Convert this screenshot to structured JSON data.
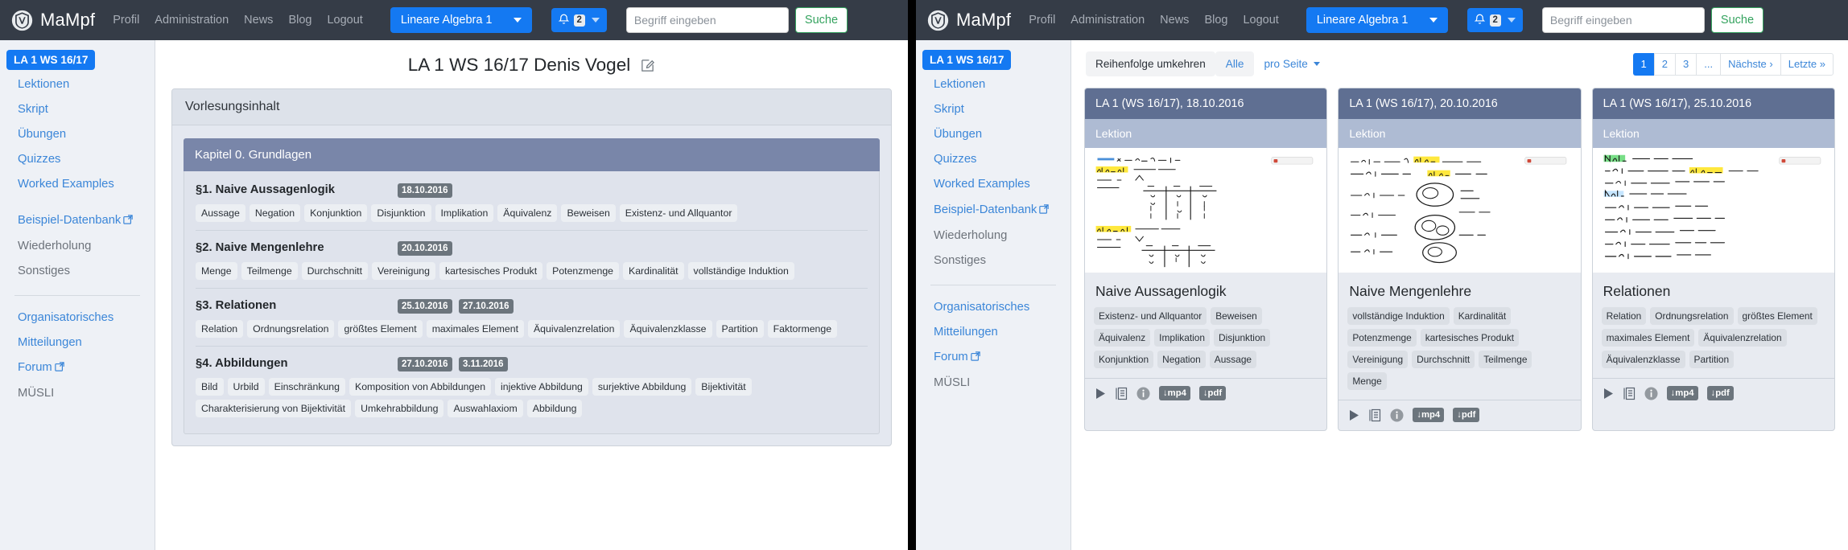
{
  "navbar": {
    "brand": "MaMpf",
    "logo_icon": "mampf-shield-logo-icon",
    "links": [
      "Profil",
      "Administration",
      "News",
      "Blog",
      "Logout"
    ],
    "course_selector": {
      "label": "Lineare Algebra 1",
      "icon": "chevron-down-icon"
    },
    "notifications": {
      "icon": "bell-icon",
      "count": "2",
      "caret_icon": "chevron-down-icon"
    },
    "search": {
      "placeholder": "Begriff eingeben",
      "value": "",
      "button": "Suche",
      "icon": "search-icon"
    }
  },
  "sidebar": {
    "badge": "LA 1 WS 16/17",
    "group1": [
      {
        "label": "Lektionen",
        "muted": false,
        "external": false
      },
      {
        "label": "Skript",
        "muted": false,
        "external": false
      },
      {
        "label": "Übungen",
        "muted": false,
        "external": false
      },
      {
        "label": "Quizzes",
        "muted": false,
        "external": false
      },
      {
        "label": "Worked Examples",
        "muted": false,
        "external": false
      },
      {
        "label": "Beispiel-Datenbank",
        "muted": false,
        "external": true
      },
      {
        "label": "Wiederholung",
        "muted": true,
        "external": false
      },
      {
        "label": "Sonstiges",
        "muted": true,
        "external": false
      }
    ],
    "group2": [
      {
        "label": "Organisatorisches",
        "muted": false,
        "external": false
      },
      {
        "label": "Mitteilungen",
        "muted": false,
        "external": false
      },
      {
        "label": "Forum",
        "muted": false,
        "external": true
      },
      {
        "label": "MÜSLI",
        "muted": true,
        "external": false
      }
    ],
    "external_icon": "external-link-icon"
  },
  "left_pane": {
    "page_title": "LA 1 WS 16/17   Denis Vogel",
    "edit_icon": "edit-pencil-icon",
    "panel_header": "Vorlesungsinhalt",
    "chapter": "Kapitel 0. Grundlagen",
    "sections": [
      {
        "title": "§1. Naive Aussagenlogik",
        "dates": [
          "18.10.2016"
        ],
        "tags": [
          "Aussage",
          "Negation",
          "Konjunktion",
          "Disjunktion",
          "Implikation",
          "Äquivalenz",
          "Beweisen",
          "Existenz- und Allquantor"
        ]
      },
      {
        "title": "§2. Naive Mengenlehre",
        "dates": [
          "20.10.2016"
        ],
        "tags": [
          "Menge",
          "Teilmenge",
          "Durchschnitt",
          "Vereinigung",
          "kartesisches Produkt",
          "Potenzmenge",
          "Kardinalität",
          "vollständige Induktion"
        ]
      },
      {
        "title": "§3. Relationen",
        "dates": [
          "25.10.2016",
          "27.10.2016"
        ],
        "tags": [
          "Relation",
          "Ordnungsrelation",
          "größtes Element",
          "maximales Element",
          "Äquivalenzrelation",
          "Äquivalenzklasse",
          "Partition",
          "Faktormenge"
        ]
      },
      {
        "title": "§4. Abbildungen",
        "dates": [
          "27.10.2016",
          "3.11.2016"
        ],
        "tags": [
          "Bild",
          "Urbild",
          "Einschränkung",
          "Komposition von Abbildungen",
          "injektive Abbildung",
          "surjektive Abbildung",
          "Bijektivität",
          "Charakterisierung von Bijektivität",
          "Umkehrabbildung",
          "Auswahlaxiom",
          "Abbildung"
        ]
      }
    ]
  },
  "right_pane": {
    "toolbar": {
      "reverse_label": "Reihenfolge umkehren",
      "all_label": "Alle",
      "per_page_label": "pro Seite",
      "per_page_icon": "chevron-down-icon"
    },
    "pagination": {
      "pages": [
        "1",
        "2",
        "3",
        "..."
      ],
      "active": "1",
      "next": "Nächste ›",
      "last": "Letzte »"
    },
    "cards": [
      {
        "header": "LA 1 (WS 16/17), 18.10.2016",
        "subheader": "Lektion",
        "thumbnail_icon": "handwritten-lecture-thumbnail",
        "title": "Naive Aussagenlogik",
        "tags": [
          "Existenz- und Allquantor",
          "Beweisen",
          "Äquivalenz",
          "Implikation",
          "Disjunktion",
          "Konjunktion",
          "Negation",
          "Aussage"
        ],
        "actions": {
          "play_icon": "play-icon",
          "manuscript_icon": "manuscript-icon",
          "info_icon": "info-circle-icon",
          "mp4": "↓mp4",
          "pdf": "↓pdf"
        }
      },
      {
        "header": "LA 1 (WS 16/17), 20.10.2016",
        "subheader": "Lektion",
        "thumbnail_icon": "handwritten-lecture-thumbnail",
        "title": "Naive Mengenlehre",
        "tags": [
          "vollständige Induktion",
          "Kardinalität",
          "Potenzmenge",
          "kartesisches Produkt",
          "Vereinigung",
          "Durchschnitt",
          "Teilmenge",
          "Menge"
        ],
        "actions": {
          "play_icon": "play-icon",
          "manuscript_icon": "manuscript-icon",
          "info_icon": "info-circle-icon",
          "mp4": "↓mp4",
          "pdf": "↓pdf"
        }
      },
      {
        "header": "LA 1 (WS 16/17), 25.10.2016",
        "subheader": "Lektion",
        "thumbnail_icon": "handwritten-lecture-thumbnail",
        "title": "Relationen",
        "tags": [
          "Relation",
          "Ordnungsrelation",
          "größtes Element",
          "maximales Element",
          "Äquivalenzrelation",
          "Äquivalenzklasse",
          "Partition"
        ],
        "actions": {
          "play_icon": "play-icon",
          "manuscript_icon": "manuscript-icon",
          "info_icon": "info-circle-icon",
          "mp4": "↓mp4",
          "pdf": "↓pdf"
        }
      }
    ]
  },
  "colors": {
    "navbar": "#353c47",
    "primary": "#1479f2",
    "sidebar_bg": "#eef1f6",
    "chapter_header": "#7986a9",
    "card_header": "#5f6f92",
    "card_subheader": "#aebbd3",
    "badge_gray": "#6c757d",
    "search_button": "#35a35f"
  }
}
